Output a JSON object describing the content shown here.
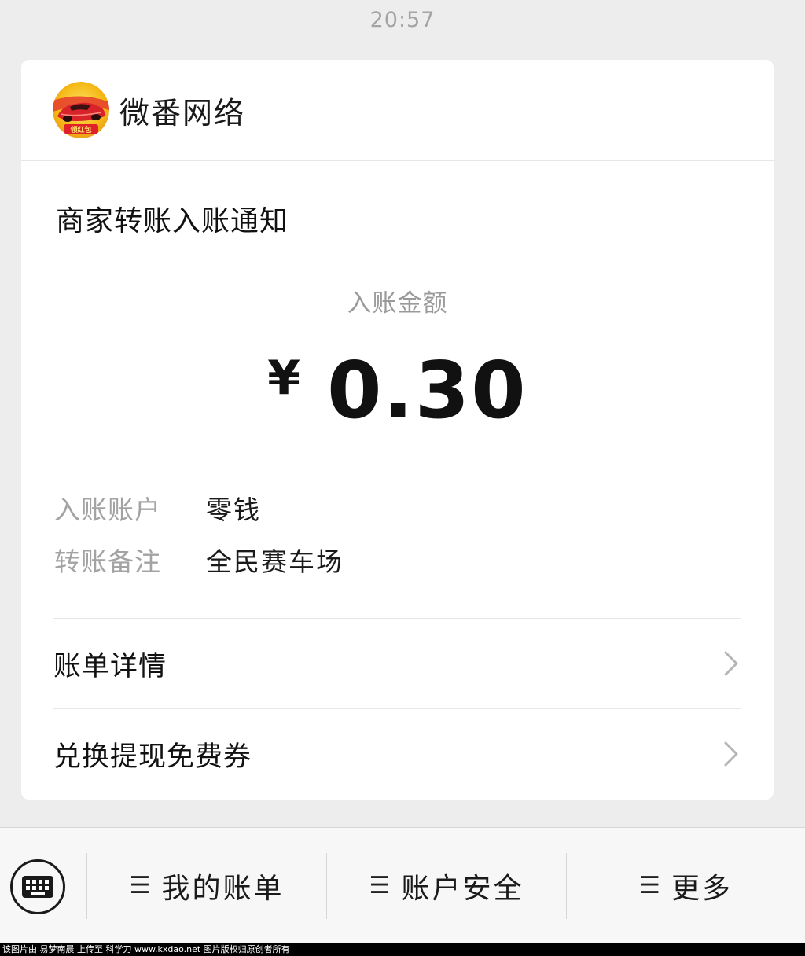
{
  "status_bar": {
    "time": "20:57"
  },
  "card": {
    "sender_name": "微番网络",
    "avatar_badge_text": "领红包",
    "notice_title": "商家转账入账通知",
    "amount_label": "入账金额",
    "currency_symbol": "¥",
    "amount": "0.30",
    "details": [
      {
        "key": "入账账户",
        "value": "零钱"
      },
      {
        "key": "转账备注",
        "value": "全民赛车场"
      }
    ],
    "links": [
      {
        "label": "账单详情"
      },
      {
        "label": "兑换提现免费券"
      }
    ]
  },
  "bottom_menu": {
    "items": [
      {
        "icon": "menu-icon",
        "label": "我的账单"
      },
      {
        "icon": "menu-icon",
        "label": "账户安全"
      },
      {
        "icon": "menu-icon",
        "label": "更多"
      }
    ]
  },
  "footer": {
    "watermark": "该图片由 易梦南晨 上传至 科学刀 www.kxdao.net 图片版权归原创者所有"
  },
  "colors": {
    "background": "#ededed",
    "card": "#ffffff",
    "avatar_red": "#d8232a",
    "avatar_yellow": "#f5c518"
  }
}
